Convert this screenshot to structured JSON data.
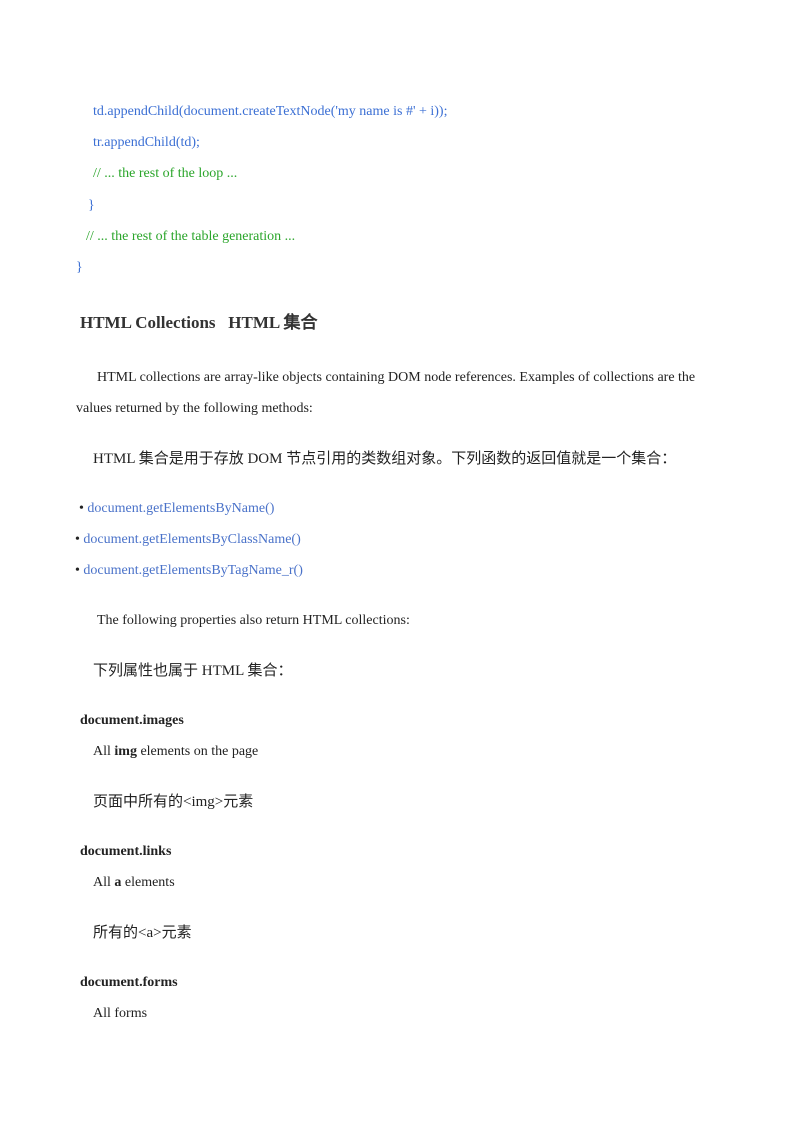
{
  "code": {
    "line1": "td.appendChild(document.createTextNode('my name is #' + i));",
    "line2": "tr.appendChild(td);",
    "line3": "// ... the rest of the loop ...",
    "line4": "}",
    "line5": "// ... the rest of the table generation ...",
    "line6": "}"
  },
  "section": {
    "heading": "HTML Collections   HTML 集合",
    "intro_en_1": "HTML collections are array-like objects containing DOM node references. Examples of collections are the",
    "intro_en_2": "values returned by the following methods:",
    "intro_cn": "HTML 集合是用于存放 DOM 节点引用的类数组对象。下列函数的返回值就是一个集合：",
    "methods": [
      "document.getElementsByName()",
      "document.getElementsByClassName()",
      "document.getElementsByTagName_r()"
    ],
    "bullet": "•",
    "props_en": "The following properties also return HTML collections:",
    "props_cn": "下列属性也属于 HTML 集合："
  },
  "properties": [
    {
      "name": "document.images",
      "desc_prefix": "All ",
      "desc_bold": "img",
      "desc_suffix": " elements on the page",
      "cn": "页面中所有的<img>元素"
    },
    {
      "name": "document.links",
      "desc_prefix": "All ",
      "desc_bold": "a",
      "desc_suffix": " elements",
      "cn": "所有的<a>元素"
    },
    {
      "name": "document.forms",
      "desc": "All forms"
    }
  ]
}
